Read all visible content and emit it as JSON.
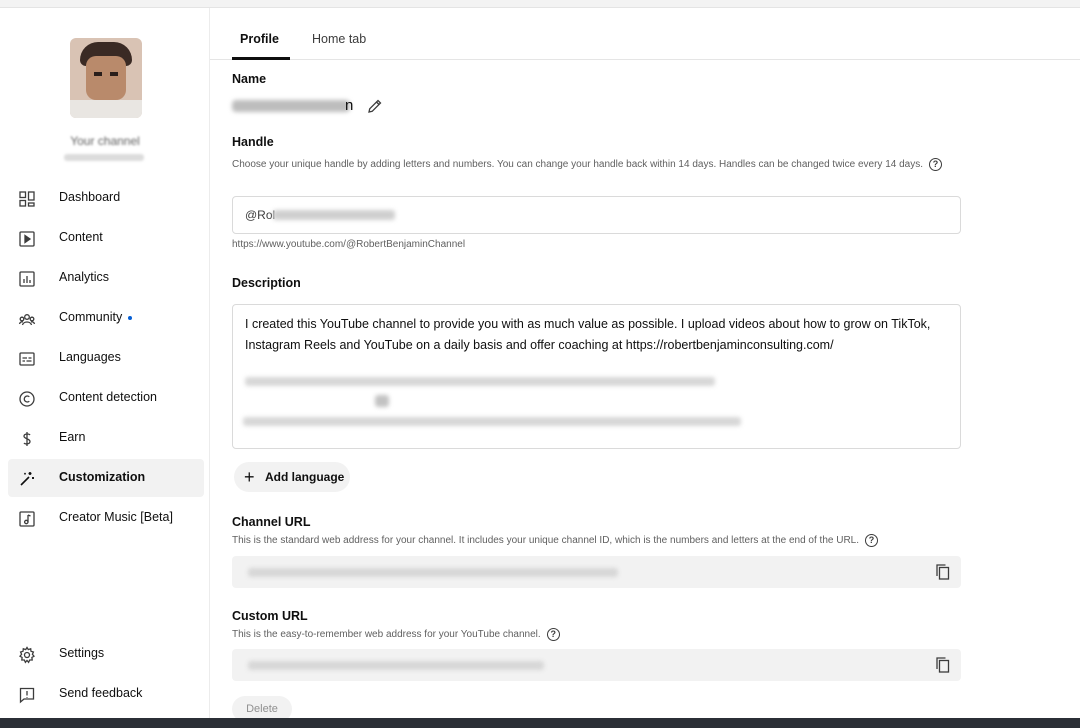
{
  "sidebar": {
    "channel_label": "Your channel",
    "items": [
      {
        "label": "Dashboard",
        "icon": "dashboard-icon"
      },
      {
        "label": "Content",
        "icon": "content-icon"
      },
      {
        "label": "Analytics",
        "icon": "analytics-icon"
      },
      {
        "label": "Community",
        "icon": "community-icon"
      },
      {
        "label": "Languages",
        "icon": "languages-icon"
      },
      {
        "label": "Content detection",
        "icon": "copyright-icon"
      },
      {
        "label": "Earn",
        "icon": "dollar-icon"
      },
      {
        "label": "Customization",
        "icon": "magic-wand-icon"
      },
      {
        "label": "Creator Music [Beta]",
        "icon": "music-icon"
      }
    ],
    "settings_label": "Settings",
    "feedback_label": "Send feedback",
    "active_item": "Customization"
  },
  "tabs": [
    {
      "label": "Profile"
    },
    {
      "label": "Home tab"
    }
  ],
  "name": {
    "label": "Name",
    "value_visible_suffix": "n"
  },
  "handle": {
    "label": "Handle",
    "help": "Choose your unique handle by adding letters and numbers. You can change your handle back within 14 days. Handles can be changed twice every 14 days.",
    "value_prefix": "@Rol",
    "url": "https://www.youtube.com/@RobertBenjaminChannel"
  },
  "description": {
    "label": "Description",
    "text": "I created this YouTube channel to provide you with as much value as possible. I upload videos about how to grow on TikTok, Instagram Reels and YouTube on a daily basis and offer coaching at https://robertbenjaminconsulting.com/"
  },
  "add_language_label": "Add language",
  "channel_url": {
    "label": "Channel URL",
    "help": "This is the standard web address for your channel. It includes your unique channel ID, which is the numbers and letters at the end of the URL."
  },
  "custom_url": {
    "label": "Custom URL",
    "help": "This is the easy-to-remember web address for your YouTube channel."
  },
  "delete_label": "Delete",
  "colors": {
    "accent": "#065fd4",
    "field_bg": "#f2f2f2",
    "text": "#0f0f0f"
  }
}
